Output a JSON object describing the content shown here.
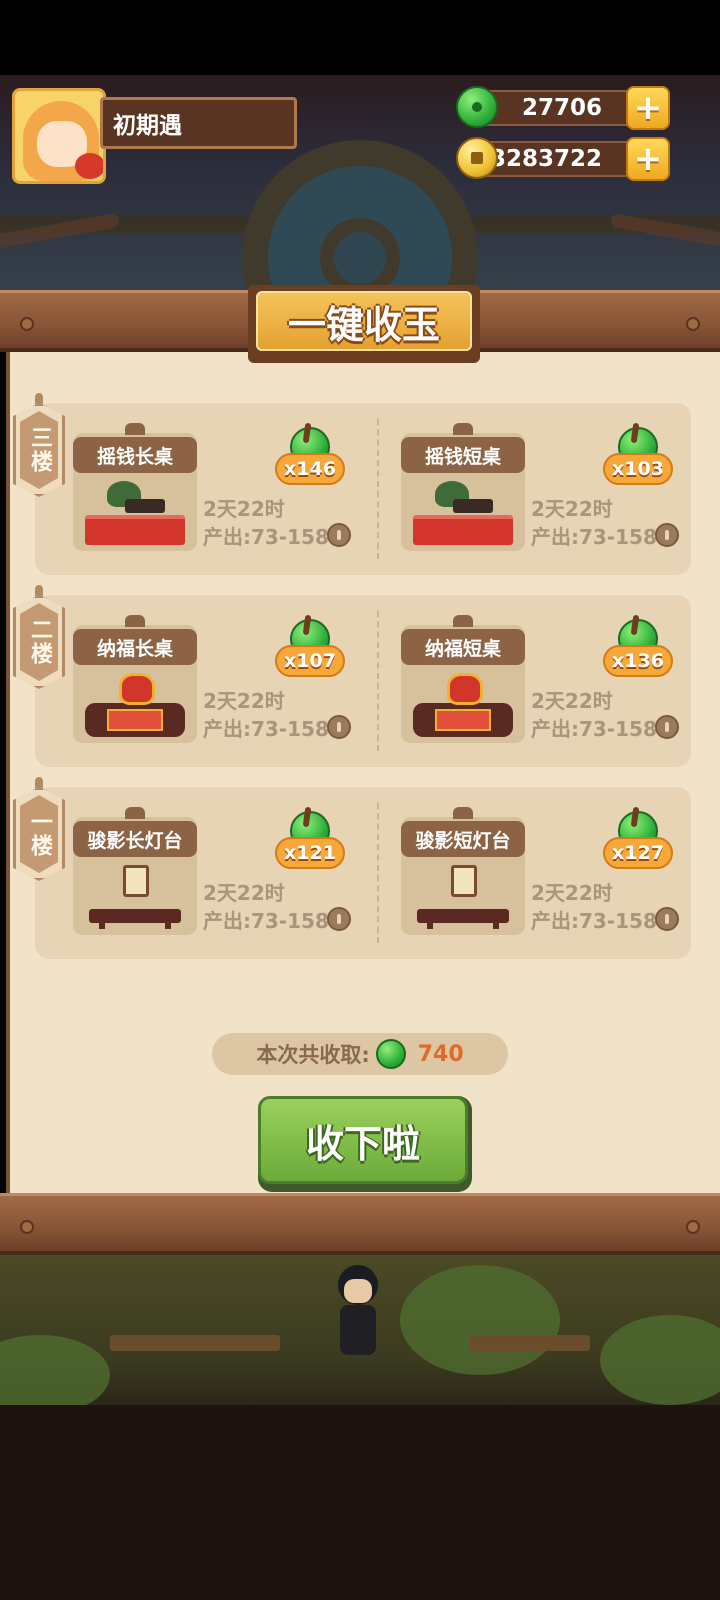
{
  "player": {
    "name": "初期遇"
  },
  "currencies": [
    {
      "type": "jade",
      "icon": "jade-icon",
      "value": "27706"
    },
    {
      "type": "coin",
      "icon": "coin-icon",
      "value": "3283722"
    }
  ],
  "dialog": {
    "title": "一键收玉",
    "floors": [
      {
        "label": "三楼",
        "items": [
          {
            "name": "摇钱长桌",
            "count": "x146",
            "time": "2天22时",
            "output": "产出:73-158"
          },
          {
            "name": "摇钱短桌",
            "count": "x103",
            "time": "2天22时",
            "output": "产出:73-158"
          }
        ]
      },
      {
        "label": "二楼",
        "items": [
          {
            "name": "纳福长桌",
            "count": "x107",
            "time": "2天22时",
            "output": "产出:73-158"
          },
          {
            "name": "纳福短桌",
            "count": "x136",
            "time": "2天22时",
            "output": "产出:73-158"
          }
        ]
      },
      {
        "label": "一楼",
        "items": [
          {
            "name": "骏影长灯台",
            "count": "x121",
            "time": "2天22时",
            "output": "产出:73-158"
          },
          {
            "name": "骏影短灯台",
            "count": "x127",
            "time": "2天22时",
            "output": "产出:73-158"
          }
        ]
      }
    ],
    "total_label": "本次共收取:",
    "total_value": "740",
    "collect_label": "收下啦"
  },
  "colors": {
    "panel_bg": "#f1e3c8",
    "wood": "#8a5637",
    "jade_green": "#2fb03a",
    "badge_orange": "#f6a93a",
    "button_green": "#7fbf48",
    "total_value": "#e06a2a"
  }
}
